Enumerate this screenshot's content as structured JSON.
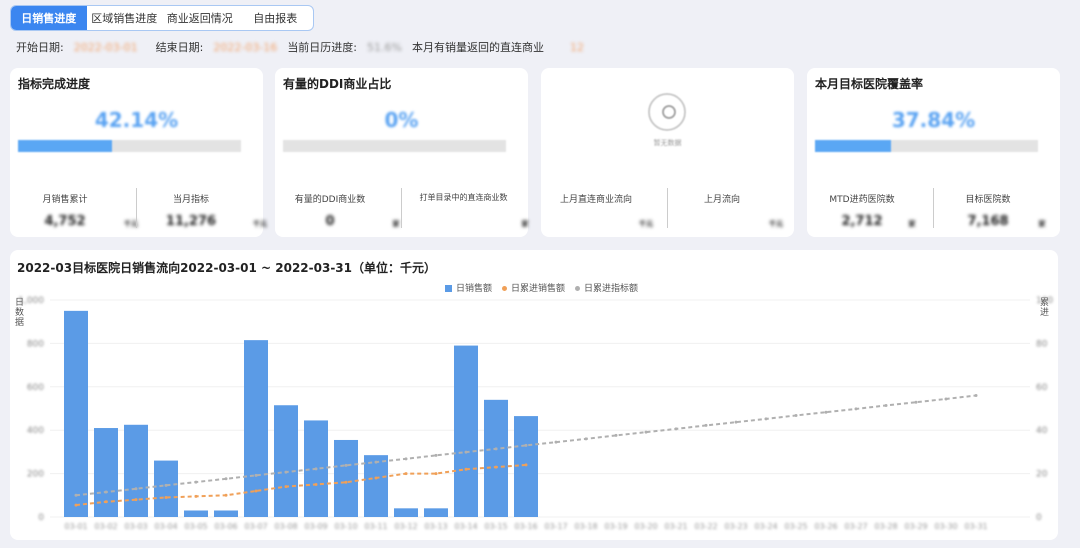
{
  "tabs": [
    "日销售进度",
    "区域销售进度",
    "商业返回情况",
    "自由报表"
  ],
  "filters": {
    "start_label": "开始日期:",
    "start_value": "2022-03-01",
    "end_label": "结束日期:",
    "end_value": "2022-03-16",
    "calendar_label": "当前日历进度:",
    "calendar_value": "51.6%",
    "returned_label": "本月有销量返回的直连商业",
    "returned_value": "12"
  },
  "cards": [
    {
      "title": "指标完成进度",
      "value": "42.14%",
      "progress": 42.14,
      "left_label": "月销售累计",
      "left_value": "4,752",
      "left_unit": "千元",
      "right_label": "当月指标",
      "right_value": "11,276",
      "right_unit": "千元"
    },
    {
      "title": "有量的DDI商业占比",
      "value": "0%",
      "progress": 0,
      "left_label": "有量的DDI商业数",
      "left_value": "0",
      "left_unit": "家",
      "right_label": "打单目录中的直连商业数",
      "right_value": "",
      "right_unit": "家"
    },
    {
      "title": "",
      "empty_text": "暂无数据",
      "left_label": "上月直连商业流向",
      "left_value": "",
      "left_unit": "千元",
      "right_label": "上月流向",
      "right_value": "",
      "right_unit": "千元"
    },
    {
      "title": "本月目标医院覆盖率",
      "value": "37.84%",
      "progress": 37.84,
      "left_label": "MTD进药医院数",
      "left_value": "2,712",
      "left_unit": "家",
      "right_label": "目标医院数",
      "right_value": "7,168",
      "right_unit": "家"
    }
  ],
  "chart_data": {
    "type": "bar",
    "title": "2022-03目标医院日销售流向2022-03-01 ~ 2022-03-31（单位：千元）",
    "ylabel": "日数据",
    "ylabel_right": "累进",
    "legend": [
      "日销售额",
      "日累进销售额",
      "日累进指标额"
    ],
    "legend_position": "top-center",
    "colors": {
      "bar": "#5b9be6",
      "cum": "#f0a058",
      "target": "#b0b0b0"
    },
    "categories": [
      "03-01",
      "03-02",
      "03-03",
      "03-04",
      "03-05",
      "03-06",
      "03-07",
      "03-08",
      "03-09",
      "03-10",
      "03-11",
      "03-12",
      "03-13",
      "03-14",
      "03-15",
      "03-16",
      "03-17",
      "03-18",
      "03-19",
      "03-20",
      "03-21",
      "03-22",
      "03-23",
      "03-24",
      "03-25",
      "03-26",
      "03-27",
      "03-28",
      "03-29",
      "03-30",
      "03-31"
    ],
    "values": [
      950,
      410,
      425,
      260,
      30,
      30,
      815,
      515,
      445,
      355,
      285,
      40,
      40,
      790,
      540,
      465
    ],
    "cum_values": [
      5.5,
      7,
      8,
      9,
      9.5,
      10,
      12,
      14,
      15,
      16,
      18,
      20,
      20,
      22,
      23,
      24
    ],
    "target_values": [
      10,
      11.5,
      13,
      14.6,
      16.1,
      17.6,
      19.2,
      20.7,
      22.2,
      23.8,
      25.3,
      26.8,
      28.4,
      29.9,
      31.4,
      33,
      34.5,
      36,
      37.6,
      39.1,
      40.6,
      42.2,
      43.7,
      45.2,
      46.8,
      48.3,
      49.8,
      51.4,
      52.9,
      54.4,
      56
    ],
    "ylim": [
      0,
      1000
    ],
    "ylim_right": [
      0,
      100
    ],
    "yticks": [
      "1,000",
      "800",
      "600",
      "400",
      "200",
      "0"
    ],
    "yticks_right": [
      "100",
      "80",
      "60",
      "40",
      "20",
      "0"
    ]
  }
}
